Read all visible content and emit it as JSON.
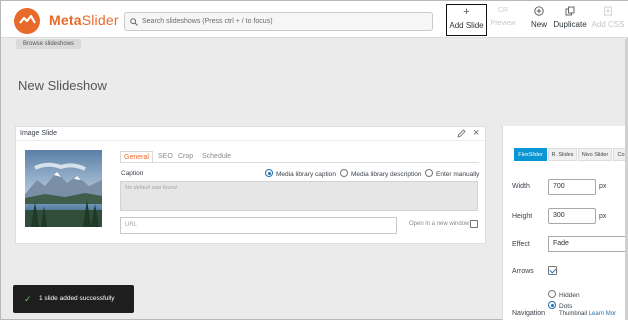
{
  "brand": {
    "name_bold": "Meta",
    "name_light": "Slider",
    "accent": "#e86a2b"
  },
  "search": {
    "placeholder": "Search slideshows (Press ctrl + / to focus)"
  },
  "toolbar": {
    "add_slide": "Add Slide",
    "preview": "Preview",
    "new": "New",
    "duplicate": "Duplicate",
    "add_css": "Add CSS"
  },
  "breadcrumb": "Browse slideshows",
  "page_title": "New Slideshow",
  "slide": {
    "header": "Image Slide",
    "tabs": [
      "General",
      "SEO",
      "Crop",
      "Schedule"
    ],
    "caption_label": "Caption",
    "caption_options": [
      "Media library caption",
      "Media library description",
      "Enter manually"
    ],
    "caption_selected": "Media library caption",
    "caption_placeholder": "No default was found",
    "url_placeholder": "URL",
    "new_window_label": "Open in a new window"
  },
  "settings": {
    "slider_tabs": [
      "FlexSlider",
      "R. Slides",
      "Nivo Slider",
      "Co"
    ],
    "active_tab": "FlexSlider",
    "width_label": "Width",
    "width_value": "700",
    "height_label": "Height",
    "height_value": "300",
    "unit": "px",
    "effect_label": "Effect",
    "effect_value": "Fade",
    "arrows_label": "Arrows",
    "arrows_checked": true,
    "navigation_label": "Navigation",
    "navigation_options": [
      "Hidden",
      "Dots"
    ],
    "navigation_selected": "Dots",
    "thumbnail_text": "Thumbnail",
    "learn_more": "Learn Mor"
  },
  "toast": {
    "message": "1 slide added successfully",
    "color": "#1e1e1e"
  },
  "colors": {
    "tab_active": "#0a96d4",
    "link": "#2271b1"
  }
}
